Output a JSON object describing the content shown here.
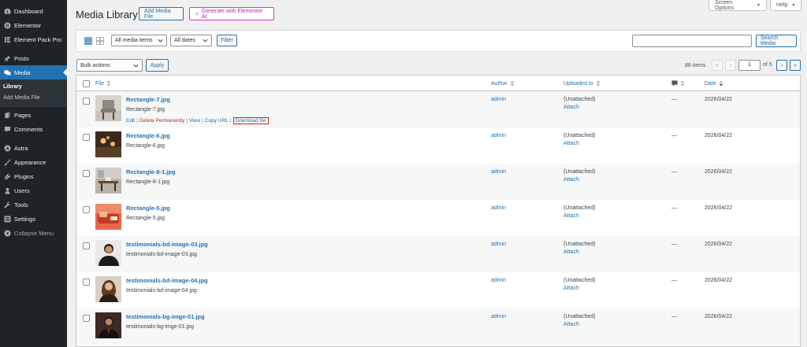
{
  "sidebar": {
    "items": [
      {
        "label": "Dashboard",
        "icon": "dashboard-icon"
      },
      {
        "label": "Elementor",
        "icon": "elementor-icon"
      },
      {
        "label": "Element Pack Pro",
        "icon": "element-pack-icon"
      },
      {
        "label": "Posts",
        "icon": "pin-icon"
      },
      {
        "label": "Media",
        "icon": "media-icon",
        "active": true
      },
      {
        "label": "Pages",
        "icon": "pages-icon"
      },
      {
        "label": "Comments",
        "icon": "comments-icon"
      },
      {
        "label": "Astra",
        "icon": "astra-icon"
      },
      {
        "label": "Appearance",
        "icon": "brush-icon"
      },
      {
        "label": "Plugins",
        "icon": "plug-icon"
      },
      {
        "label": "Users",
        "icon": "users-icon"
      },
      {
        "label": "Tools",
        "icon": "wrench-icon"
      },
      {
        "label": "Settings",
        "icon": "settings-icon"
      },
      {
        "label": "Collapse Menu",
        "icon": "collapse-icon"
      }
    ],
    "submenu": [
      "Library",
      "Add Media File"
    ]
  },
  "top": {
    "screen_options": "Screen Options",
    "help": "Help"
  },
  "header": {
    "title": "Media Library",
    "add_media": "Add Media File",
    "elementor_ai": "Generate with Elementor AI"
  },
  "filters": {
    "media_type": "All media items",
    "dates": "All dates",
    "filter_btn": "Filter",
    "search_btn": "Search Media"
  },
  "bulk": {
    "select": "Bulk actions",
    "apply": "Apply"
  },
  "pagination": {
    "count": "88 items",
    "first": "«",
    "prev": "‹",
    "current": "1",
    "of": "of 5",
    "next": "›",
    "last": "»"
  },
  "columns": {
    "file": "File",
    "author": "Author",
    "uploaded_to": "Uploaded to",
    "date": "Date"
  },
  "row_actions": {
    "edit": "Edit",
    "delete": "Delete Permanently",
    "view": "View",
    "copy_url": "Copy URL",
    "download": "Download file"
  },
  "rows": [
    {
      "title": "Rectangle-7.jpg",
      "file": "Rectangle-7.jpg",
      "author": "admin",
      "uploaded": "(Unattached)",
      "attach": "Attach",
      "comments": "—",
      "date": "2026/04/22"
    },
    {
      "title": "Rectangle-6.jpg",
      "file": "Rectangle-6.jpg",
      "author": "admin",
      "uploaded": "(Unattached)",
      "attach": "Attach",
      "comments": "—",
      "date": "2026/04/22"
    },
    {
      "title": "Rectangle-8-1.jpg",
      "file": "Rectangle-8-1.jpg",
      "author": "admin",
      "uploaded": "(Unattached)",
      "attach": "Attach",
      "comments": "—",
      "date": "2026/04/22"
    },
    {
      "title": "Rectangle-5.jpg",
      "file": "Rectangle-5.jpg",
      "author": "admin",
      "uploaded": "(Unattached)",
      "attach": "Attach",
      "comments": "—",
      "date": "2026/04/22"
    },
    {
      "title": "testimonials-bd-image-03.jpg",
      "file": "testimonials-bd-image-03.jpg",
      "author": "admin",
      "uploaded": "(Unattached)",
      "attach": "Attach",
      "comments": "—",
      "date": "2026/04/22"
    },
    {
      "title": "testimonials-bd-image-04.jpg",
      "file": "testimonials-bd-image-04.jpg",
      "author": "admin",
      "uploaded": "(Unattached)",
      "attach": "Attach",
      "comments": "—",
      "date": "2026/04/22"
    },
    {
      "title": "testimonials-bg-imge-01.jpg",
      "file": "testimonials-bg-imge-01.jpg",
      "author": "admin",
      "uploaded": "(Unattached)",
      "attach": "Attach",
      "comments": "—",
      "date": "2026/04/22"
    }
  ],
  "colors": {
    "sidebar_bg": "#1d2327",
    "accent": "#2271b1",
    "highlight_box": "#d61f1f",
    "elementor": "#d63ad0"
  }
}
